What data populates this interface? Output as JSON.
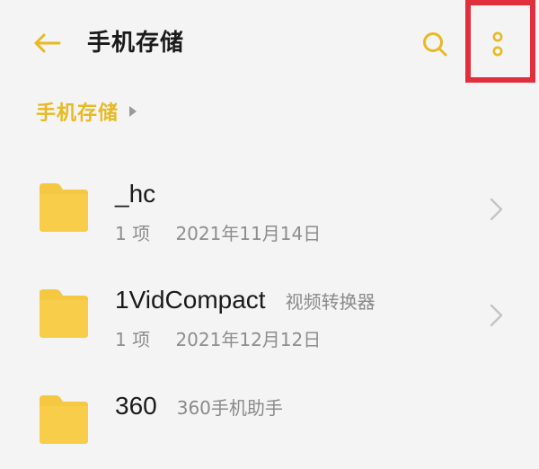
{
  "header": {
    "title": "手机存储",
    "back_icon": "arrow-left-icon",
    "search_icon": "search-icon",
    "more_icon": "more-vertical-icon"
  },
  "breadcrumb": {
    "items": [
      "手机存储"
    ]
  },
  "files": [
    {
      "name": "_hc",
      "app_label": "",
      "count": "1 项",
      "date": "2021年11月14日"
    },
    {
      "name": "1VidCompact",
      "app_label": "视频转换器",
      "count": "1 项",
      "date": "2021年12月12日"
    },
    {
      "name": "360",
      "app_label": "360手机助手",
      "count": "",
      "date": ""
    }
  ],
  "colors": {
    "accent": "#e8b921",
    "folder": "#f5c842",
    "highlight": "#e0303e",
    "background": "#f4f4f4"
  }
}
